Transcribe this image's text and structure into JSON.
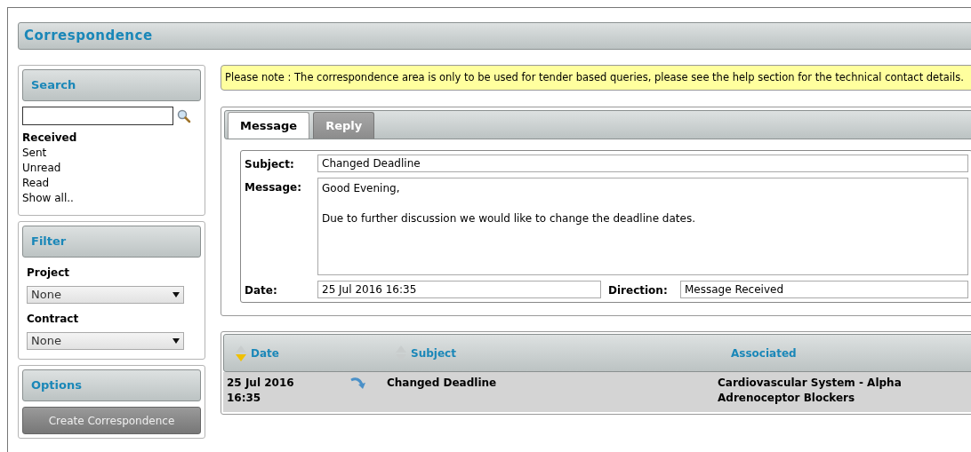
{
  "page": {
    "title": "Correspondence"
  },
  "search": {
    "title": "Search",
    "folders": [
      {
        "label": "Received",
        "selected": true
      },
      {
        "label": "Sent",
        "selected": false
      },
      {
        "label": "Unread",
        "selected": false
      },
      {
        "label": "Read",
        "selected": false
      },
      {
        "label": "Show all..",
        "selected": false
      }
    ]
  },
  "filter": {
    "title": "Filter",
    "fields": [
      {
        "label": "Project",
        "value": "None"
      },
      {
        "label": "Contract",
        "value": "None"
      }
    ]
  },
  "options": {
    "title": "Options",
    "button": "Create Correspondence"
  },
  "notice": "Please note : The correspondence area is only to be used for tender based queries, please see the help section for the technical contact details.",
  "tabs": [
    {
      "label": "Message",
      "selected": true
    },
    {
      "label": "Reply",
      "selected": false
    }
  ],
  "message": {
    "subject_label": "Subject:",
    "subject": "Changed Deadline",
    "message_label": "Message:",
    "paragraphs": [
      "Good Evening,",
      "Due to further discussion we would like to change the deadline dates."
    ],
    "date_label": "Date:",
    "date": "25 Jul 2016 16:35",
    "direction_label": "Direction:",
    "direction": "Message Received"
  },
  "table": {
    "columns": [
      {
        "label": "Date",
        "sortable": true,
        "sorted": true
      },
      {
        "label": "Subject",
        "sortable": true,
        "sorted": false
      },
      {
        "label": "Associated"
      }
    ],
    "rows": [
      {
        "date": "25 Jul 2016 16:35",
        "subject": "Changed Deadline",
        "associated": "Cardiovascular System - Alpha Adrenoceptor Blockers",
        "kind": "received"
      }
    ]
  }
}
